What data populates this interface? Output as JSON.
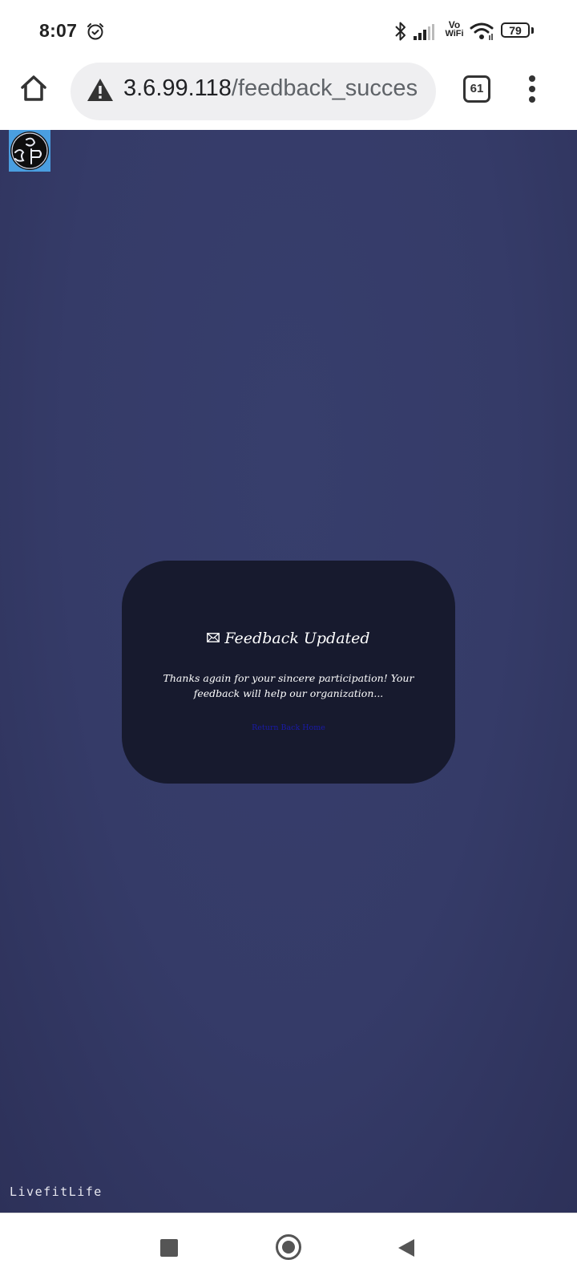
{
  "status_bar": {
    "time": "8:07",
    "vo_label": "Vo",
    "wifi_label": "WiFi",
    "battery_level": "79",
    "icons": [
      "alarm-icon",
      "bluetooth-icon",
      "signal-icon",
      "wifi-icon",
      "battery-icon"
    ]
  },
  "browser": {
    "url_host": "3.6.99.118",
    "url_path": "/feedback_succes",
    "tab_count": "61",
    "icons": [
      "home-icon",
      "warning-icon",
      "tabs-icon",
      "menu-icon"
    ]
  },
  "page": {
    "logo_text": "3P",
    "card": {
      "title": "Feedback Updated",
      "message": "Thanks again for your sincere participation! Your feedback will help our organization...",
      "link_text": "Return Back Home"
    },
    "footer_brand": "LivefitLife",
    "colors": {
      "background": "#363c6a",
      "card": "#171a2e",
      "logo_bg": "#4a9ee0",
      "link": "#1a1aa8"
    }
  },
  "nav_bar": {
    "buttons": [
      "recents-button",
      "home-button",
      "back-button"
    ]
  }
}
